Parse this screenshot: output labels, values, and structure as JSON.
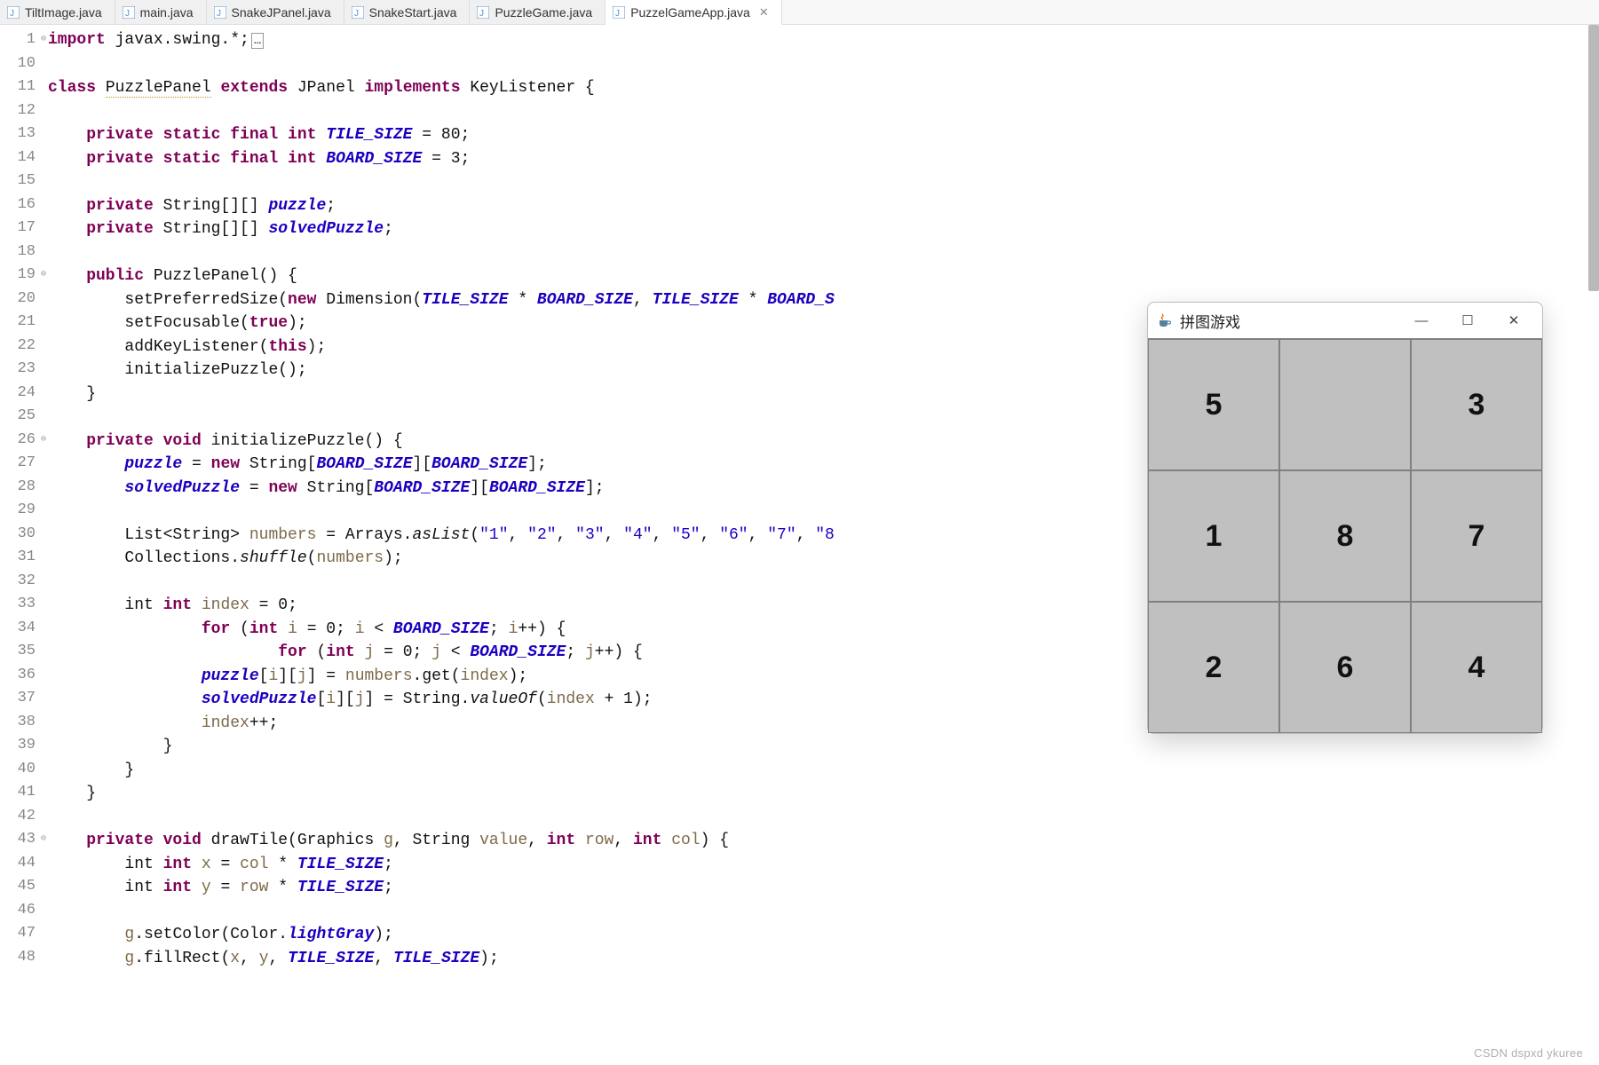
{
  "tabs": [
    {
      "label": "TiltImage.java",
      "active": false
    },
    {
      "label": "main.java",
      "active": false
    },
    {
      "label": "SnakeJPanel.java",
      "active": false
    },
    {
      "label": "SnakeStart.java",
      "active": false
    },
    {
      "label": "PuzzleGame.java",
      "active": false
    },
    {
      "label": "PuzzelGameApp.java",
      "active": true
    }
  ],
  "lineNumbers": [
    1,
    10,
    11,
    12,
    13,
    14,
    15,
    16,
    17,
    18,
    19,
    20,
    21,
    22,
    23,
    24,
    25,
    26,
    27,
    28,
    29,
    30,
    31,
    32,
    33,
    34,
    35,
    36,
    37,
    38,
    39,
    40,
    41,
    42,
    43,
    44,
    45,
    46,
    47,
    48
  ],
  "code": {
    "l1_import": "import",
    "l1_pkg": " javax.swing.*;",
    "l11_class": "class ",
    "l11_name": "PuzzlePanel",
    "l11_ext": " extends ",
    "l11_jpanel": "JPanel ",
    "l11_impl": "implements ",
    "l11_kl": "KeyListener {",
    "l13": "    private static final int ",
    "l13_c": "TILE_SIZE",
    "l13_v": " = 80;",
    "l14": "    private static final int ",
    "l14_c": "BOARD_SIZE",
    "l14_v": " = 3;",
    "l16": "    private ",
    "l16_t": "String[][] ",
    "l16_f": "puzzle",
    "l16_e": ";",
    "l17": "    private ",
    "l17_t": "String[][] ",
    "l17_f": "solvedPuzzle",
    "l17_e": ";",
    "l19": "    public ",
    "l19_n": "PuzzlePanel() {",
    "l20a": "        setPreferredSize(",
    "l20_new": "new ",
    "l20_dim": "Dimension(",
    "l20_c1": "TILE_SIZE",
    "l20_m1": " * ",
    "l20_c2": "BOARD_SIZE",
    "l20_cm": ", ",
    "l20_c3": "TILE_SIZE",
    "l20_m2": " * ",
    "l20_c4": "BOARD_S",
    "l21": "        setFocusable(",
    "l21_v": "true",
    "l21_e": ");",
    "l22": "        addKeyListener(",
    "l22_v": "this",
    "l22_e": ");",
    "l23": "        initializePuzzle();",
    "l24": "    }",
    "l26": "    private void ",
    "l26_n": "initializePuzzle() {",
    "l27a": "        ",
    "l27_f": "puzzle",
    "l27_eq": " = ",
    "l27_new": "new ",
    "l27_t": "String[",
    "l27_c1": "BOARD_SIZE",
    "l27_m": "][",
    "l27_c2": "BOARD_SIZE",
    "l27_e": "];",
    "l28a": "        ",
    "l28_f": "solvedPuzzle",
    "l28_eq": " = ",
    "l28_new": "new ",
    "l28_t": "String[",
    "l28_c1": "BOARD_SIZE",
    "l28_m": "][",
    "l28_c2": "BOARD_SIZE",
    "l28_e": "];",
    "l30a": "        List<String> ",
    "l30_v": "numbers",
    "l30_eq": " = Arrays.",
    "l30_m": "asList",
    "l30_p": "(",
    "l30_s1": "\"1\"",
    "l30_c": ", ",
    "l30_s2": "\"2\"",
    "l30_s3": "\"3\"",
    "l30_s4": "\"4\"",
    "l30_s5": "\"5\"",
    "l30_s6": "\"6\"",
    "l30_s7": "\"7\"",
    "l30_s8": "\"8",
    "l31a": "        Collections.",
    "l31_m": "shuffle",
    "l31_p": "(",
    "l31_v": "numbers",
    "l31_e": ");",
    "l33": "        int ",
    "l33_v": "index",
    "l33_e": " = 0;",
    "l34": "        for ",
    "l34_p": "(",
    "l34_int": "int ",
    "l34_i": "i",
    "l34_eq": " = 0; ",
    "l34_i2": "i",
    "l34_lt": " < ",
    "l34_c": "BOARD_SIZE",
    "l34_sc": "; ",
    "l34_i3": "i",
    "l34_pp": "++) {",
    "l35": "            for ",
    "l35_p": "(",
    "l35_int": "int ",
    "l35_j": "j",
    "l35_eq": " = 0; ",
    "l35_j2": "j",
    "l35_lt": " < ",
    "l35_c": "BOARD_SIZE",
    "l35_sc": "; ",
    "l35_j3": "j",
    "l35_pp": "++) {",
    "l36a": "                ",
    "l36_f": "puzzle",
    "l36_b": "[",
    "l36_i": "i",
    "l36_m": "][",
    "l36_j": "j",
    "l36_e": "] = ",
    "l36_v": "numbers",
    "l36_g": ".get(",
    "l36_idx": "index",
    "l36_cp": ");",
    "l37a": "                ",
    "l37_f": "solvedPuzzle",
    "l37_b": "[",
    "l37_i": "i",
    "l37_m": "][",
    "l37_j": "j",
    "l37_e": "] = String.",
    "l37_val": "valueOf",
    "l37_p": "(",
    "l37_idx": "index",
    "l37_plus": " + 1);",
    "l38a": "                ",
    "l38_v": "index",
    "l38_pp": "++;",
    "l39": "            }",
    "l40": "        }",
    "l41": "    }",
    "l43": "    private void ",
    "l43_n": "drawTile(Graphics ",
    "l43_g": "g",
    "l43_c": ", String ",
    "l43_v": "value",
    "l43_c2": ", ",
    "l43_int": "int ",
    "l43_r": "row",
    "l43_c3": ", ",
    "l43_int2": "int ",
    "l43_col": "col",
    "l43_e": ") {",
    "l44": "        int ",
    "l44_x": "x",
    "l44_eq": " = ",
    "l44_col": "col",
    "l44_m": " * ",
    "l44_c": "TILE_SIZE",
    "l44_e": ";",
    "l45": "        int ",
    "l45_y": "y",
    "l45_eq": " = ",
    "l45_row": "row",
    "l45_m": " * ",
    "l45_c": "TILE_SIZE",
    "l45_e": ";",
    "l47a": "        ",
    "l47_g": "g",
    "l47_m": ".setColor(Color.",
    "l47_lg": "lightGray",
    "l47_e": ");",
    "l48a": "        ",
    "l48_g": "g",
    "l48_m": ".fillRect(",
    "l48_x": "x",
    "l48_c": ", ",
    "l48_y": "y",
    "l48_c2": ", ",
    "l48_ts": "TILE_SIZE",
    "l48_c3": ", ",
    "l48_ts2": "TILE_SIZE",
    "l48_e": ");"
  },
  "swing": {
    "title": "拼图游戏",
    "tiles": [
      "5",
      "",
      "3",
      "1",
      "8",
      "7",
      "2",
      "6",
      "4"
    ]
  },
  "watermark": "CSDN dspxd ykuree"
}
